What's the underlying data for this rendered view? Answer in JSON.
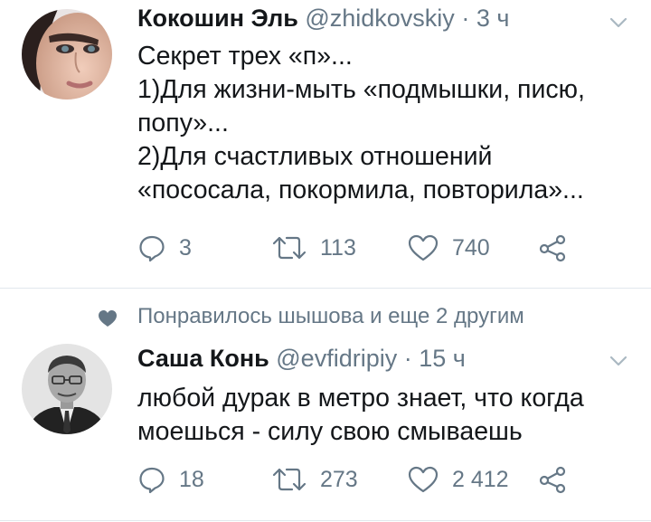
{
  "tweets": [
    {
      "name": "Кокошин Эль",
      "handle": "@zhidkovskiy",
      "separator": "·",
      "time": "3 ч",
      "lines": [
        "Секрет трех «п»...",
        "1)Для жизни-мыть «подмышки, писю,",
        "попу»...",
        "2)Для счастливых отношений",
        "«пососала, покормила, повторила»..."
      ],
      "replies": "3",
      "retweets": "113",
      "likes": "740"
    },
    {
      "name": "Саша Конь",
      "handle": "@evfidripiy",
      "separator": "·",
      "time": "15 ч",
      "lines": [
        "любой дурак в метро знает, что когда",
        "моешься - силу свою смываешь"
      ],
      "replies": "18",
      "retweets": "273",
      "likes": "2 412"
    }
  ],
  "social_context": {
    "text": "Понравилось шышова и еще 2 другим",
    "icon": "heart-icon"
  },
  "colors": {
    "text": "#14171a",
    "secondary": "#657786",
    "divider": "#e1e8ed",
    "icon": "#657786"
  }
}
